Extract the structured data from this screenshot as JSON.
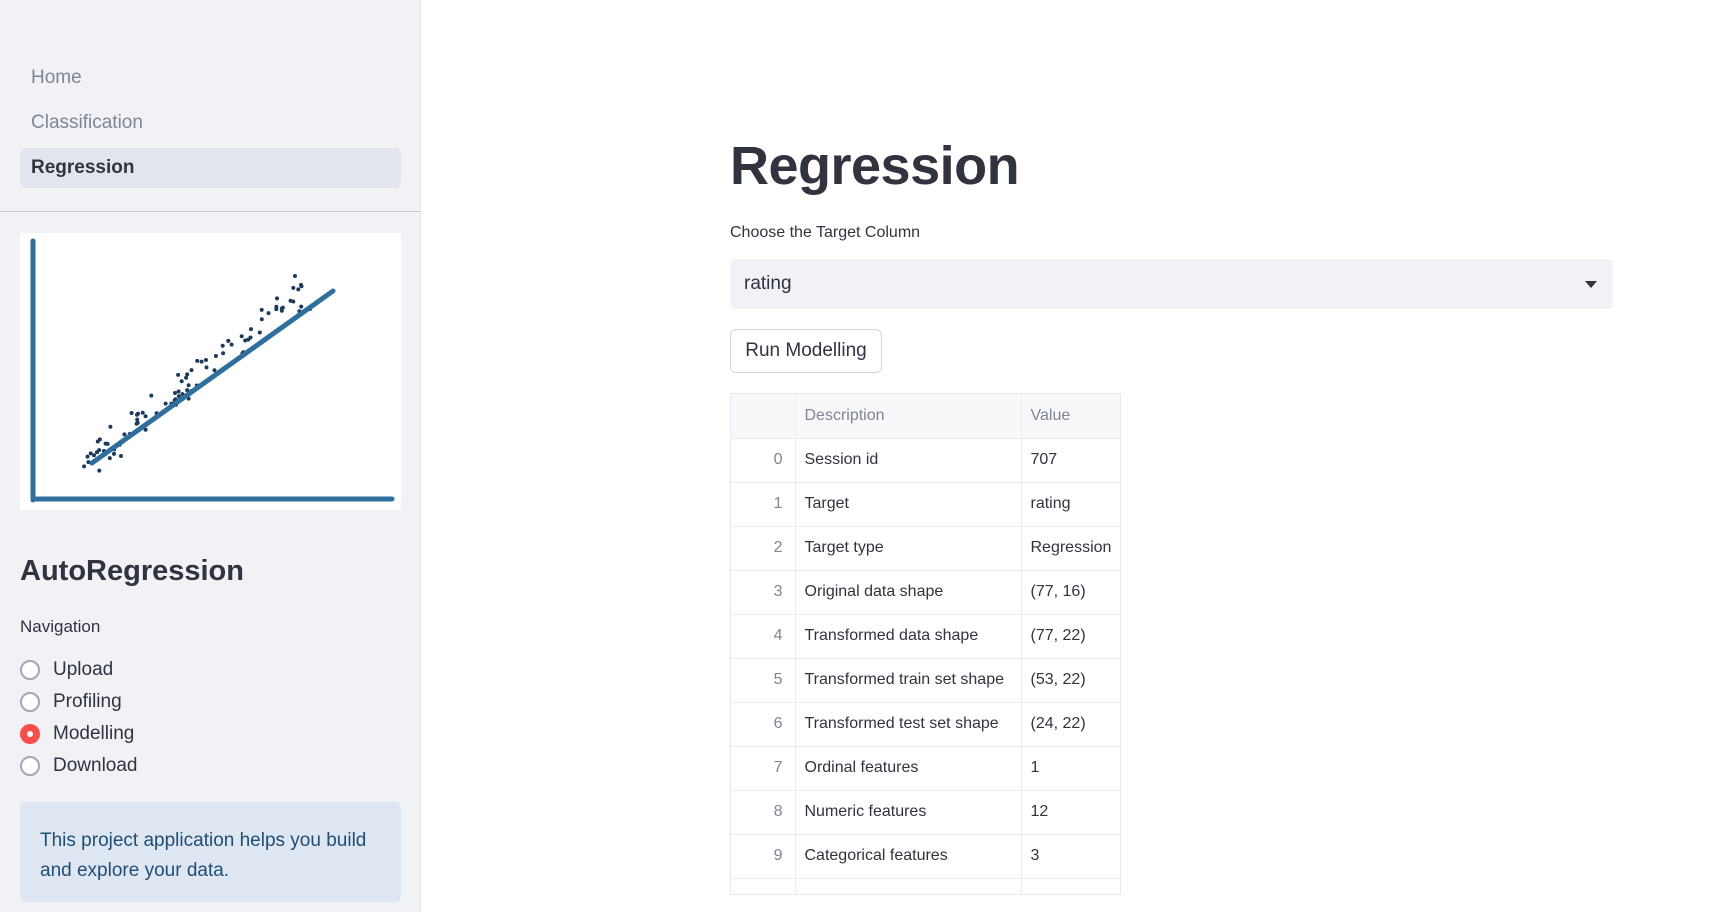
{
  "sidebar": {
    "nav_items": [
      {
        "label": "Home",
        "active": false
      },
      {
        "label": "Classification",
        "active": false
      },
      {
        "label": "Regression",
        "active": true
      }
    ],
    "image_icon": "scatter-regression-illustration",
    "app_title": "AutoRegression",
    "radio_label": "Navigation",
    "radio_options": [
      {
        "label": "Upload",
        "selected": false
      },
      {
        "label": "Profiling",
        "selected": false
      },
      {
        "label": "Modelling",
        "selected": true
      },
      {
        "label": "Download",
        "selected": false
      }
    ],
    "info_text": "This project application helps you build and explore your data."
  },
  "main": {
    "title": "Regression",
    "select_label": "Choose the Target Column",
    "select_value": "rating",
    "run_button": "Run Modelling",
    "table": {
      "columns": [
        "",
        "Description",
        "Value"
      ],
      "rows": [
        {
          "index": "0",
          "description": "Session id",
          "value": "707"
        },
        {
          "index": "1",
          "description": "Target",
          "value": "rating"
        },
        {
          "index": "2",
          "description": "Target type",
          "value": "Regression"
        },
        {
          "index": "3",
          "description": "Original data shape",
          "value": "(77, 16)"
        },
        {
          "index": "4",
          "description": "Transformed data shape",
          "value": "(77, 22)"
        },
        {
          "index": "5",
          "description": "Transformed train set shape",
          "value": "(53, 22)"
        },
        {
          "index": "6",
          "description": "Transformed test set shape",
          "value": "(24, 22)"
        },
        {
          "index": "7",
          "description": "Ordinal features",
          "value": "1"
        },
        {
          "index": "8",
          "description": "Numeric features",
          "value": "12"
        },
        {
          "index": "9",
          "description": "Categorical features",
          "value": "3"
        },
        {
          "index": "",
          "description": "",
          "value": ""
        }
      ]
    }
  },
  "colors": {
    "sidebar_bg": "#f0f2f6",
    "accent": "#ff4b4b",
    "plot_line": "#2e6f9e",
    "plot_points": "#1d3a5c",
    "info_bg": "#dde6f1",
    "info_text": "#1f4e79"
  }
}
